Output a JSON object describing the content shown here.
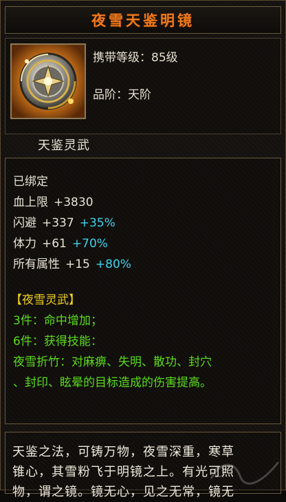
{
  "item": {
    "title": "夜雪天鉴明镜",
    "level_label": "携带等级：85级",
    "grade_label": "品阶：天阶",
    "sub_name": "天鉴灵武",
    "icon": "ornate-mirror-icon"
  },
  "stats": {
    "bound": "已绑定",
    "rows": [
      {
        "name": "血上限",
        "value": "+3830",
        "pct": ""
      },
      {
        "name": "闪避",
        "value": "+337",
        "pct": "+35%"
      },
      {
        "name": "体力",
        "value": "+61",
        "pct": "+70%"
      },
      {
        "name": "所有属性",
        "value": "+15",
        "pct": "+80%"
      }
    ]
  },
  "set": {
    "header": "【夜雪灵武】",
    "piece3": "3件：命中增加；",
    "piece6": "6件：获得技能：",
    "skill_line1": "夜雪折竹：对麻痹、失明、散功、封穴",
    "skill_line2": "、封印、眩晕的目标造成的伤害提高。"
  },
  "description": {
    "line1": "天鉴之法，可铸万物，夜雪深重，寒草",
    "line2": "锥心，其雪粉飞于明镜之上。有光可照",
    "line3": "物，谓之镜。镜无心，见之无常，镜无"
  },
  "colors": {
    "title": "#f07a1e",
    "green": "#5bdc1c",
    "cyan": "#3fd3ee",
    "yellow": "#f2d21e",
    "border": "#6b5a3f"
  }
}
